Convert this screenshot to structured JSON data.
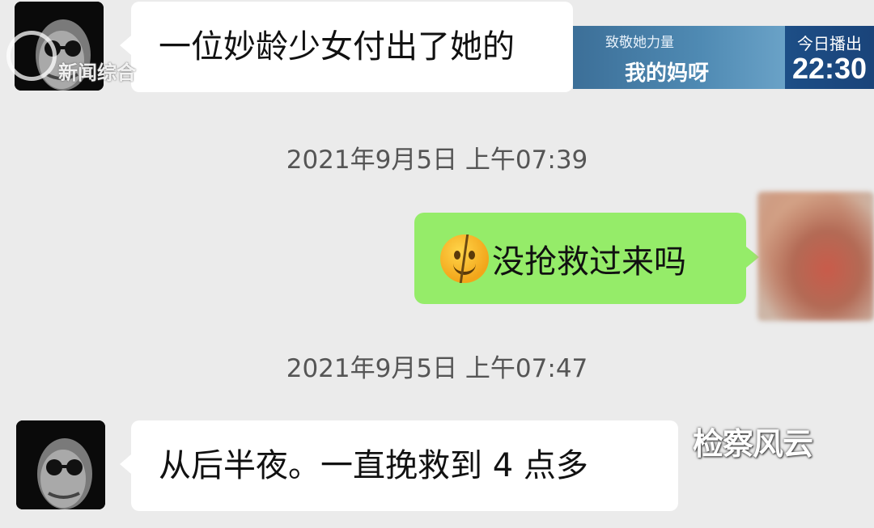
{
  "chat": {
    "messages": [
      {
        "direction": "incoming",
        "text": "一位妙龄少女付出了她的"
      },
      {
        "direction": "outgoing",
        "emoji": "cracked-smile-emoji",
        "text": "没抢救过来吗"
      },
      {
        "direction": "incoming",
        "text": "从后半夜。一直挽救到 4 点多"
      }
    ],
    "timestamps": [
      "2021年9月5日 上午07:39",
      "2021年9月5日 上午07:47"
    ]
  },
  "broadcast": {
    "subtitle": "致敬她力量",
    "title": "我的妈呀",
    "label": "今日播出",
    "time": "22:30"
  },
  "watermarks": {
    "channel": "新闻综合",
    "show": "检察风云"
  },
  "colors": {
    "background": "#ebebeb",
    "outgoing_bubble": "#95ec69",
    "incoming_bubble": "#ffffff",
    "timestamp_text": "#555555"
  }
}
